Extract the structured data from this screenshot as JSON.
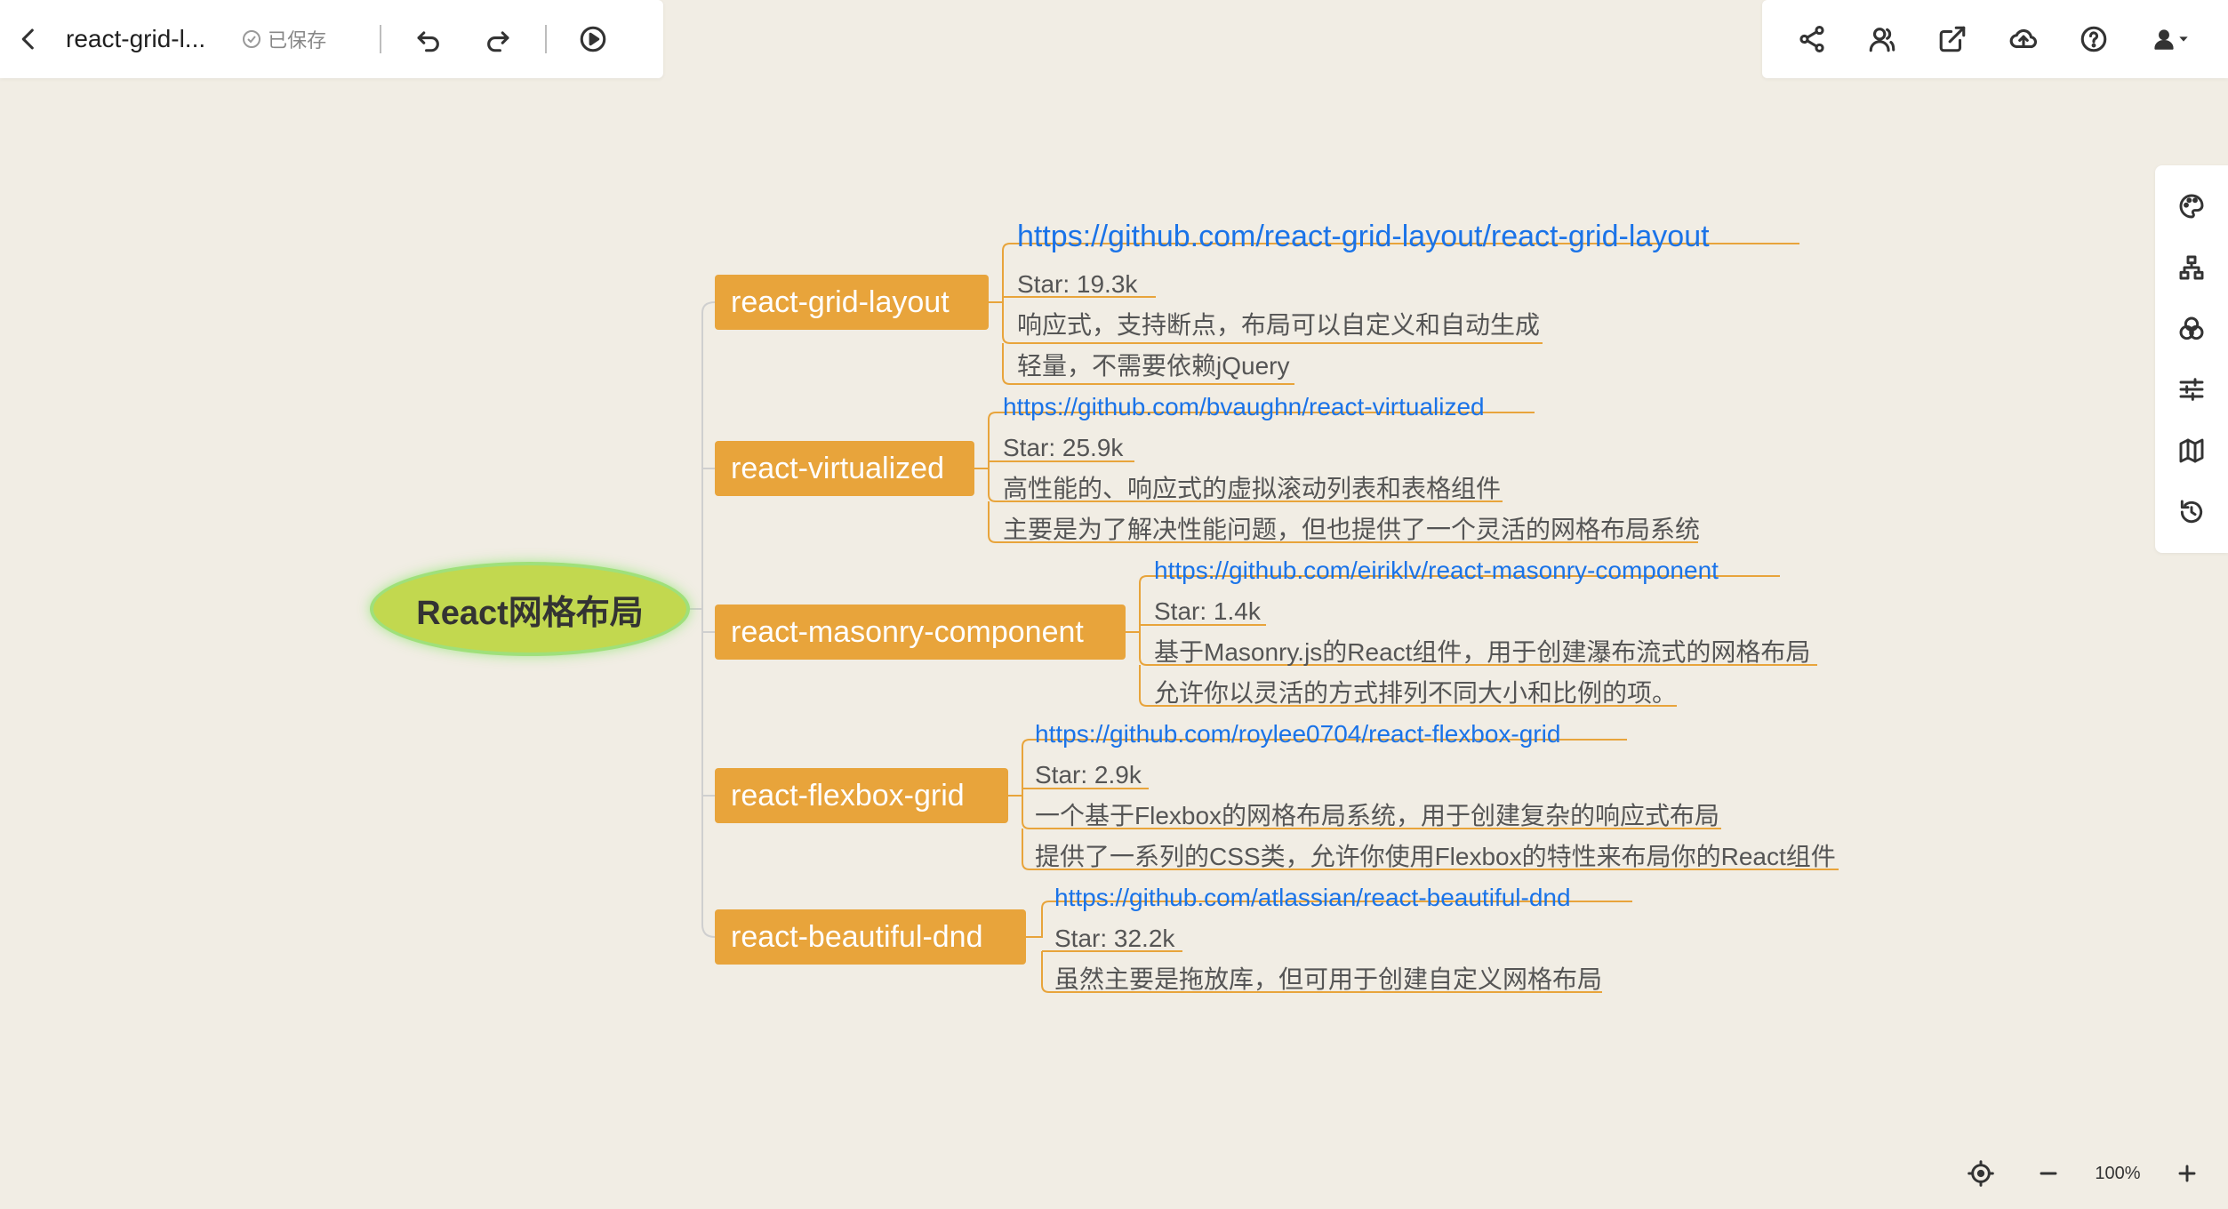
{
  "header": {
    "doc_title": "react-grid-l...",
    "save_status": "已保存"
  },
  "mindmap": {
    "root": "React网格布局",
    "branches": [
      {
        "label": "react-grid-layout",
        "leaves": [
          "https://github.com/react-grid-layout/react-grid-layout",
          "Star: 19.3k",
          "响应式，支持断点，布局可以自定义和自动生成",
          "轻量，不需要依赖jQuery"
        ]
      },
      {
        "label": "react-virtualized",
        "leaves": [
          "https://github.com/bvaughn/react-virtualized",
          "Star: 25.9k",
          "高性能的、响应式的虚拟滚动列表和表格组件",
          "主要是为了解决性能问题，但也提供了一个灵活的网格布局系统"
        ]
      },
      {
        "label": "react-masonry-component",
        "leaves": [
          "https://github.com/eiriklv/react-masonry-component",
          "Star: 1.4k",
          "基于Masonry.js的React组件，用于创建瀑布流式的网格布局",
          "允许你以灵活的方式排列不同大小和比例的项。"
        ]
      },
      {
        "label": "react-flexbox-grid",
        "leaves": [
          "https://github.com/roylee0704/react-flexbox-grid",
          "Star: 2.9k",
          "一个基于Flexbox的网格布局系统，用于创建复杂的响应式布局",
          "提供了一系列的CSS类，允许你使用Flexbox的特性来布局你的React组件"
        ]
      },
      {
        "label": "react-beautiful-dnd",
        "leaves": [
          "https://github.com/atlassian/react-beautiful-dnd",
          "Star: 32.2k",
          "虽然主要是拖放库，但可用于创建自定义网格布局"
        ]
      }
    ]
  },
  "zoom": {
    "level": "100%"
  },
  "colors": {
    "background": "#f1ede4",
    "branch": "#e8a43b",
    "root": "#c2d84f",
    "link": "#1a73e8",
    "connector": "#e8a43b"
  }
}
